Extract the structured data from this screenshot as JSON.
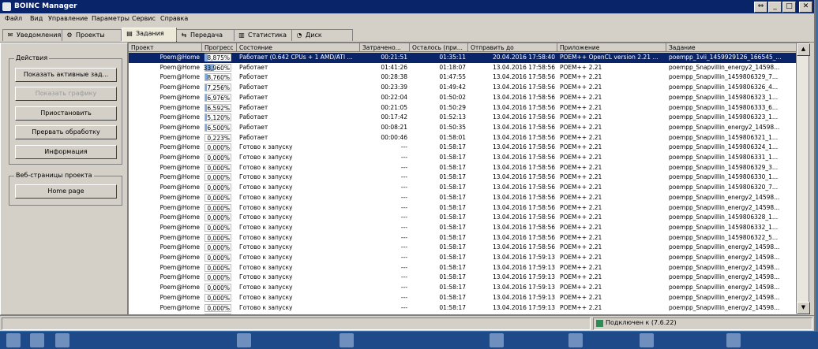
{
  "window": {
    "title": "BOINC Manager"
  },
  "menu": [
    "Файл",
    "Вид",
    "Управление",
    "Параметры",
    "Сервис",
    "Справка"
  ],
  "tabs": [
    {
      "label": "Уведомления",
      "icon": "envelope-icon"
    },
    {
      "label": "Проекты",
      "icon": "gear-icon"
    },
    {
      "label": "Задания",
      "icon": "tasks-icon",
      "active": true
    },
    {
      "label": "Передача",
      "icon": "transfer-icon"
    },
    {
      "label": "Статистика",
      "icon": "chart-icon"
    },
    {
      "label": "Диск",
      "icon": "disk-icon"
    }
  ],
  "actions": {
    "group_label": "Действия",
    "show_active": "Показать активные зад...",
    "show_graphics": "Показать графику",
    "suspend": "Приостановить",
    "abort": "Прервать обработку",
    "info": "Информация"
  },
  "webpages": {
    "group_label": "Веб-страницы проекта",
    "home": "Home page"
  },
  "columns": [
    "Проект",
    "Прогресс",
    "Состояние",
    "Затрачено...",
    "Осталось (при...",
    "Отправить до",
    "Приложение",
    "Задание"
  ],
  "rows": [
    {
      "project": "Poem@Home",
      "progress": "8,875%",
      "pct": 8.875,
      "state": "Работает (0.642 CPUs + 1 AMD/ATI ...",
      "elapsed": "00:21:51",
      "remaining": "01:35:11",
      "deadline": "20.04.2016 17:58:40",
      "app": "POEM++ OpenCL version 2.21 ...",
      "task": "poempp_1vii_1459929126_166545_...",
      "selected": true
    },
    {
      "project": "Poem@Home",
      "progress": "33,960%",
      "pct": 33.96,
      "state": "Работает",
      "elapsed": "01:41:26",
      "remaining": "01:18:07",
      "deadline": "13.04.2016 17:58:56",
      "app": "POEM++ 2.21",
      "task": "poempp_Snapvillin_energy2_14598..."
    },
    {
      "project": "Poem@Home",
      "progress": "8,760%",
      "pct": 8.76,
      "state": "Работает",
      "elapsed": "00:28:38",
      "remaining": "01:47:55",
      "deadline": "13.04.2016 17:58:56",
      "app": "POEM++ 2.21",
      "task": "poempp_Snapvillin_1459806329_7..."
    },
    {
      "project": "Poem@Home",
      "progress": "7,256%",
      "pct": 7.256,
      "state": "Работает",
      "elapsed": "00:23:39",
      "remaining": "01:49:42",
      "deadline": "13.04.2016 17:58:56",
      "app": "POEM++ 2.21",
      "task": "poempp_Snapvillin_1459806326_4..."
    },
    {
      "project": "Poem@Home",
      "progress": "6,976%",
      "pct": 6.976,
      "state": "Работает",
      "elapsed": "00:22:04",
      "remaining": "01:50:02",
      "deadline": "13.04.2016 17:58:56",
      "app": "POEM++ 2.21",
      "task": "poempp_Snapvillin_1459806323_1..."
    },
    {
      "project": "Poem@Home",
      "progress": "6,592%",
      "pct": 6.592,
      "state": "Работает",
      "elapsed": "00:21:05",
      "remaining": "01:50:29",
      "deadline": "13.04.2016 17:58:56",
      "app": "POEM++ 2.21",
      "task": "poempp_Snapvillin_1459806333_6..."
    },
    {
      "project": "Poem@Home",
      "progress": "5,120%",
      "pct": 5.12,
      "state": "Работает",
      "elapsed": "00:17:42",
      "remaining": "01:52:13",
      "deadline": "13.04.2016 17:58:56",
      "app": "POEM++ 2.21",
      "task": "poempp_Snapvillin_1459806323_1..."
    },
    {
      "project": "Poem@Home",
      "progress": "6,500%",
      "pct": 6.5,
      "state": "Работает",
      "elapsed": "00:08:21",
      "remaining": "01:50:35",
      "deadline": "13.04.2016 17:58:56",
      "app": "POEM++ 2.21",
      "task": "poempp_Snapvillin_energy2_14598..."
    },
    {
      "project": "Poem@Home",
      "progress": "0,223%",
      "pct": 0.223,
      "state": "Работает",
      "elapsed": "00:00:46",
      "remaining": "01:58:01",
      "deadline": "13.04.2016 17:58:56",
      "app": "POEM++ 2.21",
      "task": "poempp_Snapvillin_1459806321_1..."
    },
    {
      "project": "Poem@Home",
      "progress": "0,000%",
      "pct": 0,
      "state": "Готово к запуску",
      "elapsed": "---",
      "remaining": "01:58:17",
      "deadline": "13.04.2016 17:58:56",
      "app": "POEM++ 2.21",
      "task": "poempp_Snapvillin_1459806324_1..."
    },
    {
      "project": "Poem@Home",
      "progress": "0,000%",
      "pct": 0,
      "state": "Готово к запуску",
      "elapsed": "---",
      "remaining": "01:58:17",
      "deadline": "13.04.2016 17:58:56",
      "app": "POEM++ 2.21",
      "task": "poempp_Snapvillin_1459806331_1..."
    },
    {
      "project": "Poem@Home",
      "progress": "0,000%",
      "pct": 0,
      "state": "Готово к запуску",
      "elapsed": "---",
      "remaining": "01:58:17",
      "deadline": "13.04.2016 17:58:56",
      "app": "POEM++ 2.21",
      "task": "poempp_Snapvillin_1459806329_3..."
    },
    {
      "project": "Poem@Home",
      "progress": "0,000%",
      "pct": 0,
      "state": "Готово к запуску",
      "elapsed": "---",
      "remaining": "01:58:17",
      "deadline": "13.04.2016 17:58:56",
      "app": "POEM++ 2.21",
      "task": "poempp_Snapvillin_1459806330_1..."
    },
    {
      "project": "Poem@Home",
      "progress": "0,000%",
      "pct": 0,
      "state": "Готово к запуску",
      "elapsed": "---",
      "remaining": "01:58:17",
      "deadline": "13.04.2016 17:58:56",
      "app": "POEM++ 2.21",
      "task": "poempp_Snapvillin_1459806320_7..."
    },
    {
      "project": "Poem@Home",
      "progress": "0,000%",
      "pct": 0,
      "state": "Готово к запуску",
      "elapsed": "---",
      "remaining": "01:58:17",
      "deadline": "13.04.2016 17:58:56",
      "app": "POEM++ 2.21",
      "task": "poempp_Snapvillin_energy2_14598..."
    },
    {
      "project": "Poem@Home",
      "progress": "0,000%",
      "pct": 0,
      "state": "Готово к запуску",
      "elapsed": "---",
      "remaining": "01:58:17",
      "deadline": "13.04.2016 17:58:56",
      "app": "POEM++ 2.21",
      "task": "poempp_Snapvillin_energy2_14598..."
    },
    {
      "project": "Poem@Home",
      "progress": "0,000%",
      "pct": 0,
      "state": "Готово к запуску",
      "elapsed": "---",
      "remaining": "01:58:17",
      "deadline": "13.04.2016 17:58:56",
      "app": "POEM++ 2.21",
      "task": "poempp_Snapvillin_1459806328_1..."
    },
    {
      "project": "Poem@Home",
      "progress": "0,000%",
      "pct": 0,
      "state": "Готово к запуску",
      "elapsed": "---",
      "remaining": "01:58:17",
      "deadline": "13.04.2016 17:58:56",
      "app": "POEM++ 2.21",
      "task": "poempp_Snapvillin_1459806332_1..."
    },
    {
      "project": "Poem@Home",
      "progress": "0,000%",
      "pct": 0,
      "state": "Готово к запуску",
      "elapsed": "---",
      "remaining": "01:58:17",
      "deadline": "13.04.2016 17:58:56",
      "app": "POEM++ 2.21",
      "task": "poempp_Snapvillin_1459806322_5..."
    },
    {
      "project": "Poem@Home",
      "progress": "0,000%",
      "pct": 0,
      "state": "Готово к запуску",
      "elapsed": "---",
      "remaining": "01:58:17",
      "deadline": "13.04.2016 17:58:56",
      "app": "POEM++ 2.21",
      "task": "poempp_Snapvillin_energy2_14598..."
    },
    {
      "project": "Poem@Home",
      "progress": "0,000%",
      "pct": 0,
      "state": "Готово к запуску",
      "elapsed": "---",
      "remaining": "01:58:17",
      "deadline": "13.04.2016 17:59:13",
      "app": "POEM++ 2.21",
      "task": "poempp_Snapvillin_energy2_14598..."
    },
    {
      "project": "Poem@Home",
      "progress": "0,000%",
      "pct": 0,
      "state": "Готово к запуску",
      "elapsed": "---",
      "remaining": "01:58:17",
      "deadline": "13.04.2016 17:59:13",
      "app": "POEM++ 2.21",
      "task": "poempp_Snapvillin_energy2_14598..."
    },
    {
      "project": "Poem@Home",
      "progress": "0,000%",
      "pct": 0,
      "state": "Готово к запуску",
      "elapsed": "---",
      "remaining": "01:58:17",
      "deadline": "13.04.2016 17:59:13",
      "app": "POEM++ 2.21",
      "task": "poempp_Snapvillin_energy2_14598..."
    },
    {
      "project": "Poem@Home",
      "progress": "0,000%",
      "pct": 0,
      "state": "Готово к запуску",
      "elapsed": "---",
      "remaining": "01:58:17",
      "deadline": "13.04.2016 17:59:13",
      "app": "POEM++ 2.21",
      "task": "poempp_Snapvillin_energy2_14598..."
    },
    {
      "project": "Poem@Home",
      "progress": "0,000%",
      "pct": 0,
      "state": "Готово к запуску",
      "elapsed": "---",
      "remaining": "01:58:17",
      "deadline": "13.04.2016 17:59:13",
      "app": "POEM++ 2.21",
      "task": "poempp_Snapvillin_energy2_14598..."
    },
    {
      "project": "Poem@Home",
      "progress": "0,000%",
      "pct": 0,
      "state": "Готово к запуску",
      "elapsed": "---",
      "remaining": "01:58:17",
      "deadline": "13.04.2016 17:59:13",
      "app": "POEM++ 2.21",
      "task": "poempp_Snapvillin_energy2_14598..."
    },
    {
      "project": "Poem@Home",
      "progress": "0,000%",
      "pct": 0,
      "state": "Готово к запуску",
      "elapsed": "---",
      "remaining": "01:58:17",
      "deadline": "13.04.2016 17:59:13",
      "app": "POEM++ 2.21",
      "task": "poempp_Snapvillin_energy2_14598..."
    }
  ],
  "status": {
    "connection": "Подключен к  (7.6.22)"
  },
  "colors": {
    "selection": "#0a246a",
    "titlebar": "#0a246a",
    "progress_fill": "#7fa7d8"
  }
}
